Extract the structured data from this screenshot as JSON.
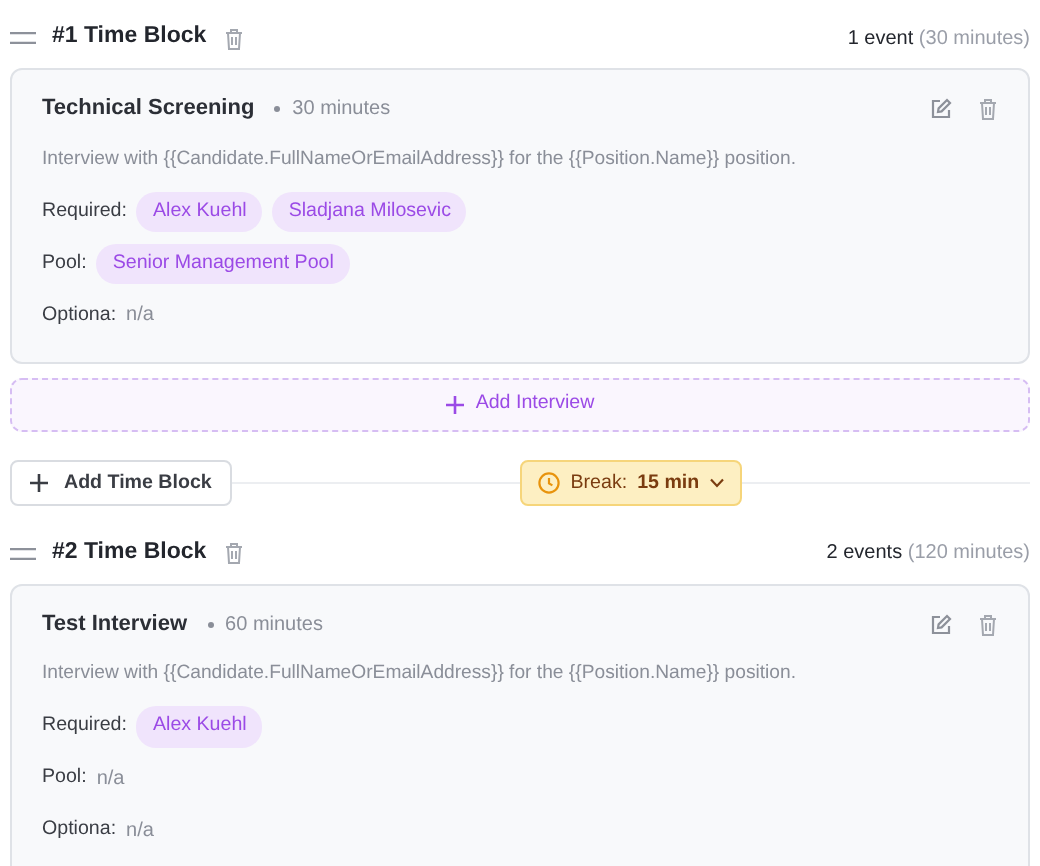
{
  "blocks": [
    {
      "title": "#1 Time Block",
      "count": "1 event",
      "duration": "(30 minutes)",
      "interviews": [
        {
          "title": "Technical Screening",
          "duration": "30 minutes",
          "description": "Interview with {{Candidate.FullNameOrEmailAddress}} for the {{Position.Name}} position.",
          "rows": [
            {
              "label": "Required:",
              "tags": [
                "Alex Kuehl",
                "Sladjana Milosevic"
              ]
            },
            {
              "label": "Pool:",
              "tags": [
                "Senior Management Pool"
              ]
            },
            {
              "label": "Optiona:",
              "value": "n/a"
            }
          ]
        }
      ],
      "add_interview": "Add Interview"
    },
    {
      "title": "#2 Time Block",
      "count": "2 events",
      "duration": "(120 minutes)",
      "interviews": [
        {
          "title": "Test Interview",
          "duration": "60 minutes",
          "description": "Interview with {{Candidate.FullNameOrEmailAddress}} for the {{Position.Name}} position.",
          "rows": [
            {
              "label": "Required:",
              "tags": [
                "Alex Kuehl"
              ]
            },
            {
              "label": "Pool:",
              "value": "n/a"
            },
            {
              "label": "Optiona:",
              "value": "n/a"
            }
          ]
        }
      ]
    }
  ],
  "between": {
    "add_time_block": "Add Time Block",
    "break_label": "Break:",
    "break_value": "15 min"
  }
}
